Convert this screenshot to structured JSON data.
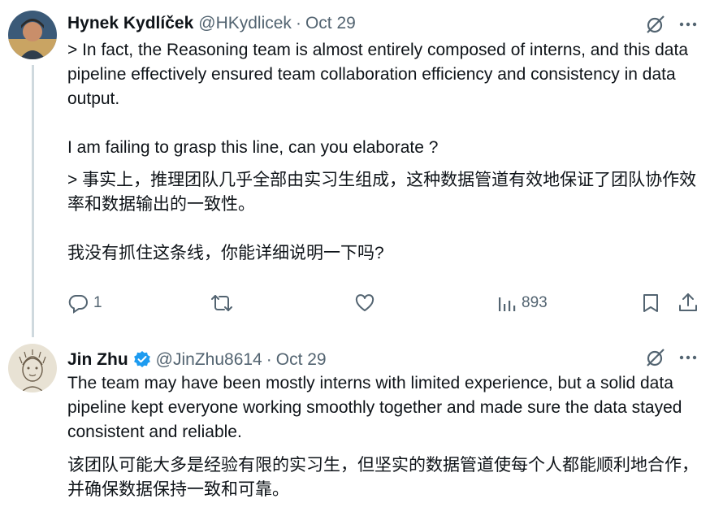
{
  "tweet1": {
    "author_name": "Hynek Kydlíček",
    "handle": "@HKydlicek",
    "separator": "·",
    "date": "Oct 29",
    "text_en_quote": "> In fact, the Reasoning team is almost entirely composed of interns, and this data pipeline effectively ensured team collaboration efficiency and consistency in data output.",
    "text_en_question": "I am failing to grasp this line, can you elaborate ?",
    "text_zh_quote": "> 事实上，推理团队几乎全部由实习生组成，这种数据管道有效地保证了团队协作效率和数据输出的一致性。",
    "text_zh_question": "我没有抓住这条线，你能详细说明一下吗?",
    "actions": {
      "reply_count": "1",
      "views_count": "893"
    },
    "icons": [
      "grok-icon",
      "more-icon",
      "reply-icon",
      "retweet-icon",
      "like-icon",
      "views-icon",
      "bookmark-icon",
      "share-icon"
    ]
  },
  "tweet2": {
    "author_name": "Jin Zhu",
    "handle": "@JinZhu8614",
    "separator": "·",
    "date": "Oct 29",
    "text_en": "The team may have been mostly interns with limited experience, but a solid data pipeline kept everyone working smoothly together and made sure the data stayed consistent and reliable.",
    "text_zh": "该团队可能大多是经验有限的实习生，但坚实的数据管道使每个人都能顺利地合作，并确保数据保持一致和可靠。",
    "verified": true
  },
  "colors": {
    "text": "#0f1419",
    "secondary": "#536471",
    "thread_line": "#cfd9de",
    "verified": "#1d9bf0"
  }
}
